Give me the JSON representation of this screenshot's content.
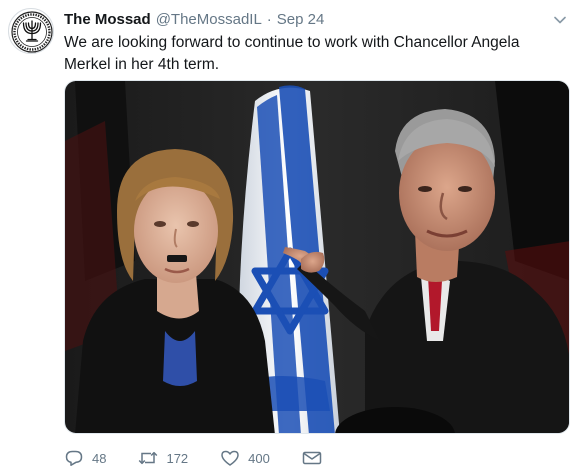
{
  "tweet": {
    "author": {
      "display_name": "The Mossad",
      "handle": "@TheMossadIL"
    },
    "separator": "·",
    "timestamp": "Sep 24",
    "text": "We are looking forward to continue to work with Chancellor Angela Merkel in her 4th term."
  },
  "actions": {
    "reply_count": "48",
    "retweet_count": "172",
    "like_count": "400"
  },
  "icons": {
    "avatar": "mossad-emblem-icon",
    "menu": "chevron-down-icon",
    "reply": "reply-icon",
    "retweet": "retweet-icon",
    "like": "heart-icon",
    "dm": "envelope-icon"
  },
  "colors": {
    "text_primary": "#14171a",
    "text_secondary": "#657786",
    "border": "#e1e8ed",
    "flag_blue": "#1b4fb5"
  }
}
